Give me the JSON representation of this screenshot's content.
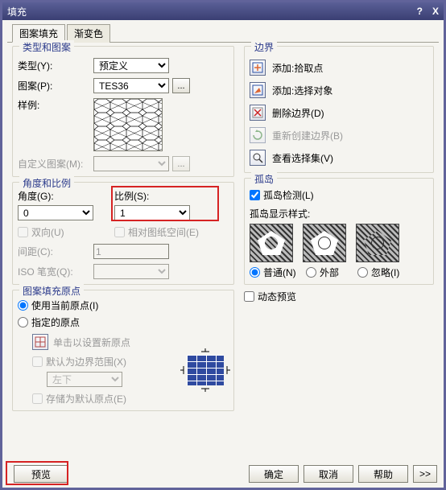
{
  "window": {
    "title": "填充",
    "help_icon": "?",
    "close_icon": "X"
  },
  "tabs": [
    {
      "label": "图案填充",
      "active": true
    },
    {
      "label": "渐变色",
      "active": false
    }
  ],
  "left": {
    "group_type_title": "类型和图案",
    "type_label": "类型(Y):",
    "type_value": "预定义",
    "pattern_label": "图案(P):",
    "pattern_value": "TES36",
    "pattern_browse": "...",
    "sample_label": "样例:",
    "custom_label": "自定义图案(M):",
    "group_angle_title": "角度和比例",
    "angle_label": "角度(G):",
    "angle_value": "0",
    "scale_label": "比例(S):",
    "scale_value": "1",
    "bidir_label": "双向(U)",
    "relpaper_label": "相对图纸空间(E)",
    "spacing_label": "间距(C):",
    "spacing_value": "1",
    "iso_label": "ISO 笔宽(Q):",
    "group_origin_title": "图案填充原点",
    "origin_opt1": "使用当前原点(I)",
    "origin_opt2": "指定的原点",
    "origin_pick": "单击以设置新原点",
    "origin_default_bounds": "默认为边界范围(X)",
    "origin_corner_value": "左下",
    "origin_store": "存储为默认原点(E)"
  },
  "right": {
    "group_boundary_title": "边界",
    "b_add_pick": "添加:拾取点",
    "b_add_select": "添加:选择对象",
    "b_delete": "删除边界(D)",
    "b_recreate": "重新创建边界(B)",
    "b_view": "查看选择集(V)",
    "group_island_title": "孤岛",
    "island_detect": "孤岛检测(L)",
    "island_style_label": "孤岛显示样式:",
    "island_opts": [
      {
        "label": "普通(N)"
      },
      {
        "label": "外部"
      },
      {
        "label": "忽略(I)"
      }
    ],
    "dynamic_preview": "动态预览"
  },
  "buttons": {
    "preview": "预览",
    "ok": "确定",
    "cancel": "取消",
    "help": "帮助",
    "more": ">>"
  }
}
